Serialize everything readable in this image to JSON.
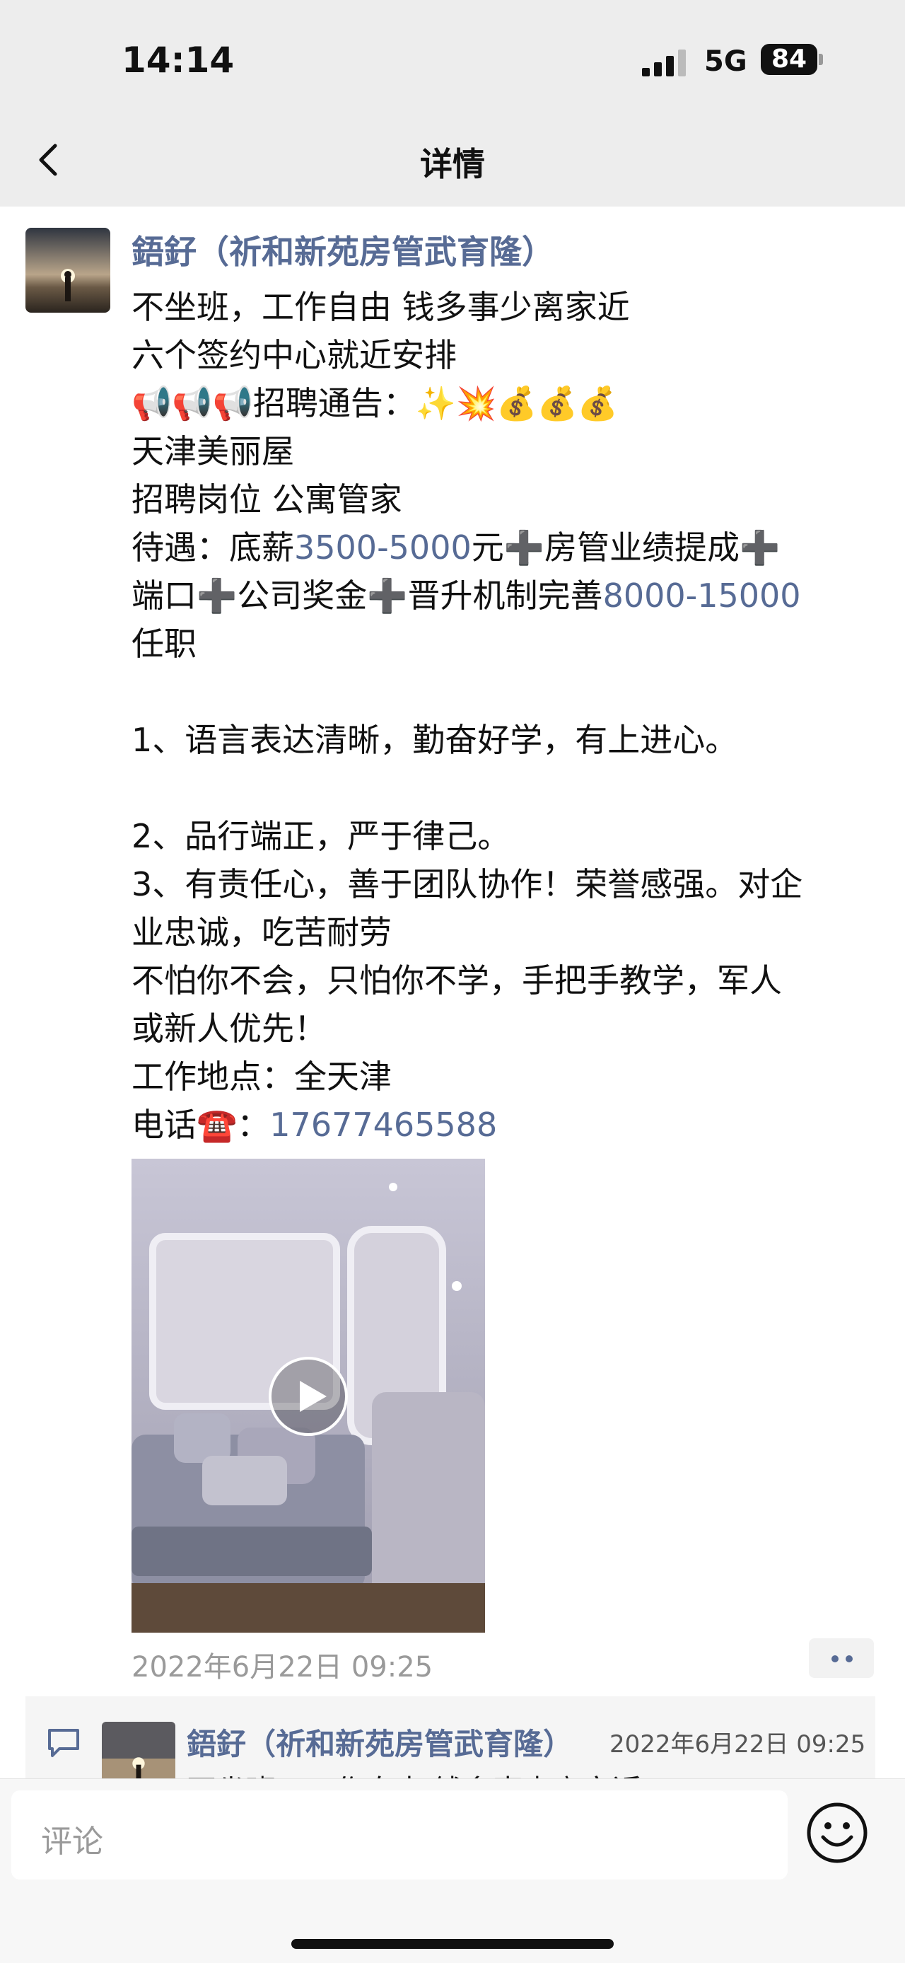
{
  "status": {
    "time": "14:14",
    "network": "5G",
    "battery": "84"
  },
  "nav": {
    "title": "详情",
    "back_icon": "chevron-left-icon"
  },
  "post": {
    "author": "鋙釨（祈和新苑房管武育隆）",
    "lines": [
      "不坐班，工作自由 钱多事少离家近",
      " 六个签约中心就近安排",
      "📢📢📢招聘通告：✨💥💰💰💰",
      "天津美丽屋",
      "招聘岗位 公寓管家",
      "待遇：底薪",
      "3500-5000",
      "元➕房管业绩提成➕",
      "端口➕公司奖金➕晋升机制完善",
      "8000-15000",
      "  任职",
      "1、语言表达清晰，勤奋好学，有上进心。",
      "2、品行端正，严于律己。",
      "3、有责任心，善于团队协作！荣誉感强。对企",
      "业忠诚，吃苦耐劳",
      "不怕你不会，只怕你不学，手把手教学，军人",
      "或新人优先！",
      "工作地点：全天津",
      "电话☎️：",
      "17677465588"
    ],
    "date": "2022年6月22日 09:25"
  },
  "comment": {
    "name": "鋙釨（祈和新苑房管武育隆）",
    "date": "2022年6月22日 09:25",
    "text": "不坐班，工作自由 钱多事少离家近"
  },
  "input": {
    "placeholder": "评论"
  },
  "colors": {
    "link": "#576b95",
    "bar": "#ededed"
  }
}
